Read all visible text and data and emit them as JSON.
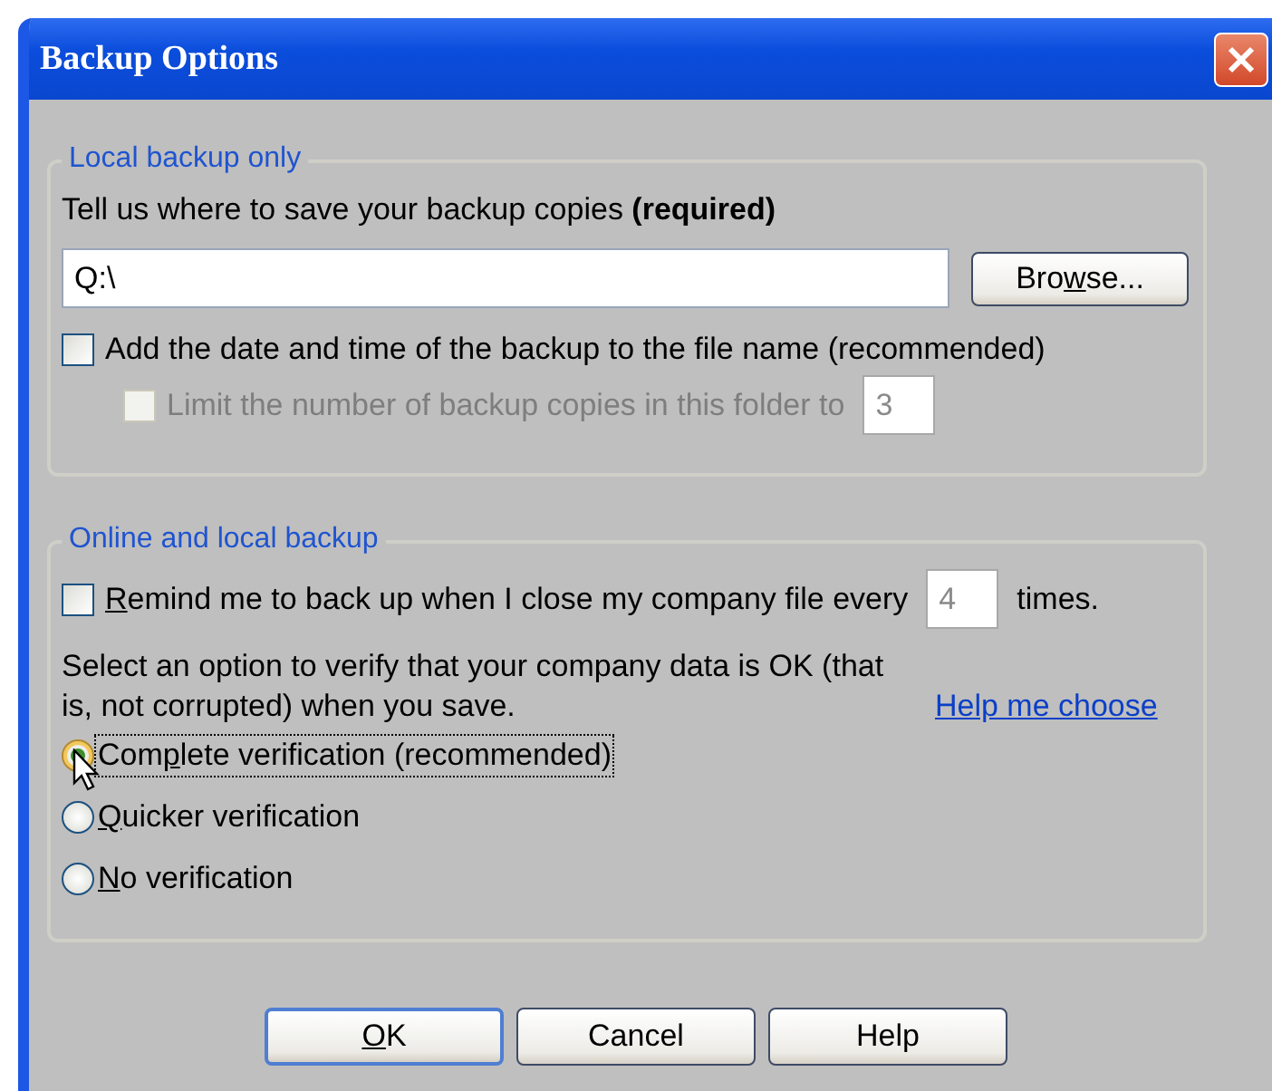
{
  "window": {
    "title": "Backup Options"
  },
  "local_backup": {
    "heading": "Local backup only",
    "prompt": "Tell us where to save your backup copies **(required)**",
    "location": {
      "value": "Q:\\"
    },
    "browse_button": {
      "pre": "Bro",
      "key": "w",
      "post": "se..."
    },
    "add_date": {
      "label": {
        "text": "Add the date and time of the backup to the file name (recommended)"
      },
      "checked": false,
      "disabled": false
    },
    "limit_copies": {
      "label": {
        "text": "Limit the number of backup copies in this folder to"
      },
      "checked": false,
      "disabled": true,
      "count": "3"
    }
  },
  "online_backup": {
    "heading": "Online and local backup",
    "remind": {
      "label": {
        "key": "R",
        "post": "emind me to back up when I close my company file every"
      },
      "checked": false,
      "disabled": false,
      "count": "4",
      "suffix": "times."
    },
    "instruction": "Select an option to verify that your company data is OK (that is, not corrupted) when you save.",
    "help_link": "Help me choose",
    "verification": [
      {
        "label": {
          "pre": "Com",
          "key": "p",
          "post": "lete verification (recommended)"
        },
        "selected": true,
        "focused": true
      },
      {
        "label": {
          "key": "Q",
          "post": "uicker verification"
        },
        "selected": false,
        "focused": false
      },
      {
        "label": {
          "key": "N",
          "post": "o verification"
        },
        "selected": false,
        "focused": false
      }
    ]
  },
  "buttons": [
    {
      "label": {
        "key": "O",
        "post": "K"
      },
      "default": true
    },
    {
      "label": {
        "text": "Cancel"
      },
      "default": false
    },
    {
      "label": {
        "text": "Help"
      },
      "default": false
    }
  ]
}
